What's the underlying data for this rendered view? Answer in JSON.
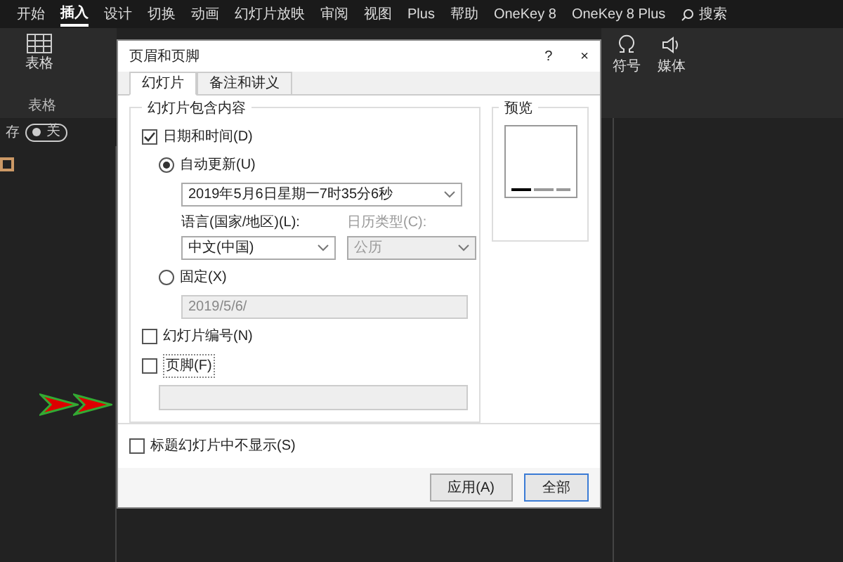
{
  "ribbon_tabs": [
    {
      "label": "开始",
      "selected": false
    },
    {
      "label": "插入",
      "selected": true
    },
    {
      "label": "设计",
      "selected": false
    },
    {
      "label": "切换",
      "selected": false
    },
    {
      "label": "动画",
      "selected": false
    },
    {
      "label": "幻灯片放映",
      "selected": false
    },
    {
      "label": "审阅",
      "selected": false
    },
    {
      "label": "视图",
      "selected": false
    },
    {
      "label": "Plus",
      "selected": false
    },
    {
      "label": "帮助",
      "selected": false
    },
    {
      "label": "OneKey 8",
      "selected": false
    },
    {
      "label": "OneKey 8 Plus",
      "selected": false
    }
  ],
  "search": {
    "label": "搜索"
  },
  "ribbon": {
    "table_button": "表格",
    "group_label": "表格",
    "symbol_button": "符号",
    "media_button": "媒体",
    "autosave": {
      "label": "存",
      "state": "关",
      "on": false
    }
  },
  "dialog": {
    "title": "页眉和页脚",
    "help": "?",
    "close": "×",
    "tabs": [
      {
        "label": "幻灯片",
        "selected": true
      },
      {
        "label": "备注和讲义",
        "selected": false
      }
    ],
    "group_title": "幻灯片包含内容",
    "date_time": {
      "label": "日期和时间(D)",
      "checked": true
    },
    "auto_update": {
      "label": "自动更新(U)",
      "selected": true,
      "value": "2019年5月6日星期一7时35分6秒"
    },
    "language": {
      "label": "语言(国家/地区)(L):",
      "value": "中文(中国)",
      "disabled": false
    },
    "calendar": {
      "label": "日历类型(C):",
      "value": "公历",
      "disabled": true
    },
    "fixed": {
      "label": "固定(X)",
      "selected": false,
      "value": "2019/5/6/",
      "disabled": true
    },
    "slide_number": {
      "label": "幻灯片编号(N)",
      "checked": false
    },
    "footer": {
      "label": "页脚(F)",
      "checked": false
    },
    "hide_on_title": {
      "label": "标题幻灯片中不显示(S)",
      "checked": false
    },
    "preview_title": "预览",
    "buttons": [
      "应用(A)",
      "全部"
    ]
  }
}
